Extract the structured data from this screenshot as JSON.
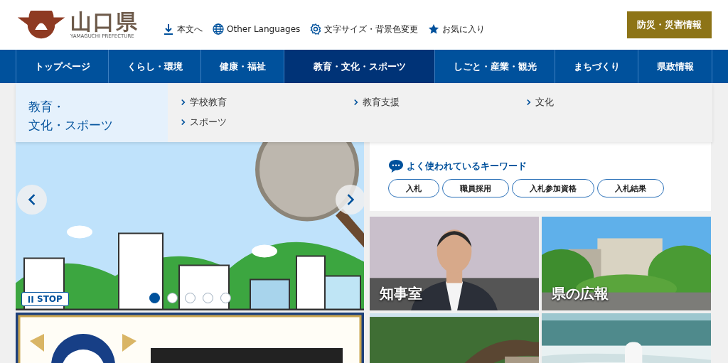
{
  "header": {
    "logo": {
      "title": "山口県",
      "subtitle": "YAMAGUCHI PREFECTURE"
    },
    "utility_links": [
      {
        "label": "本文へ",
        "kind": "download"
      },
      {
        "label": "Other Languages",
        "kind": "globe"
      },
      {
        "label": "文字サイズ・背景色変更",
        "kind": "gear"
      },
      {
        "label": "お気に入り",
        "kind": "star"
      }
    ],
    "emergency_button": "防災・災害情報"
  },
  "nav": {
    "items": [
      {
        "label": "トップページ",
        "selected": false
      },
      {
        "label": "くらし・環境",
        "selected": false
      },
      {
        "label": "健康・福祉",
        "selected": false
      },
      {
        "label": "教育・文化・スポーツ",
        "selected": true
      },
      {
        "label": "しごと・産業・観光",
        "selected": false
      },
      {
        "label": "まちづくり",
        "selected": false
      },
      {
        "label": "県政情報",
        "selected": false
      }
    ]
  },
  "mega_menu": {
    "heading_lines": [
      "教育・",
      "文化・スポーツ"
    ],
    "links": [
      "学校教育",
      "教育支援",
      "文化",
      "スポーツ"
    ]
  },
  "carousel": {
    "stop_button": "STOP",
    "dots": [
      {
        "selected": true
      },
      {
        "selected": false
      },
      {
        "selected": false
      },
      {
        "selected": false
      },
      {
        "selected": false
      }
    ]
  },
  "keywords": {
    "heading": "よく使われているキーワード",
    "tags": [
      "入札",
      "職員採用",
      "入札参加資格",
      "入札結果"
    ]
  },
  "tiles": [
    {
      "label": "知事室",
      "kind": "person"
    },
    {
      "label": "県の広報",
      "kind": "building"
    },
    {
      "kind": "bridge"
    },
    {
      "kind": "river"
    }
  ]
}
